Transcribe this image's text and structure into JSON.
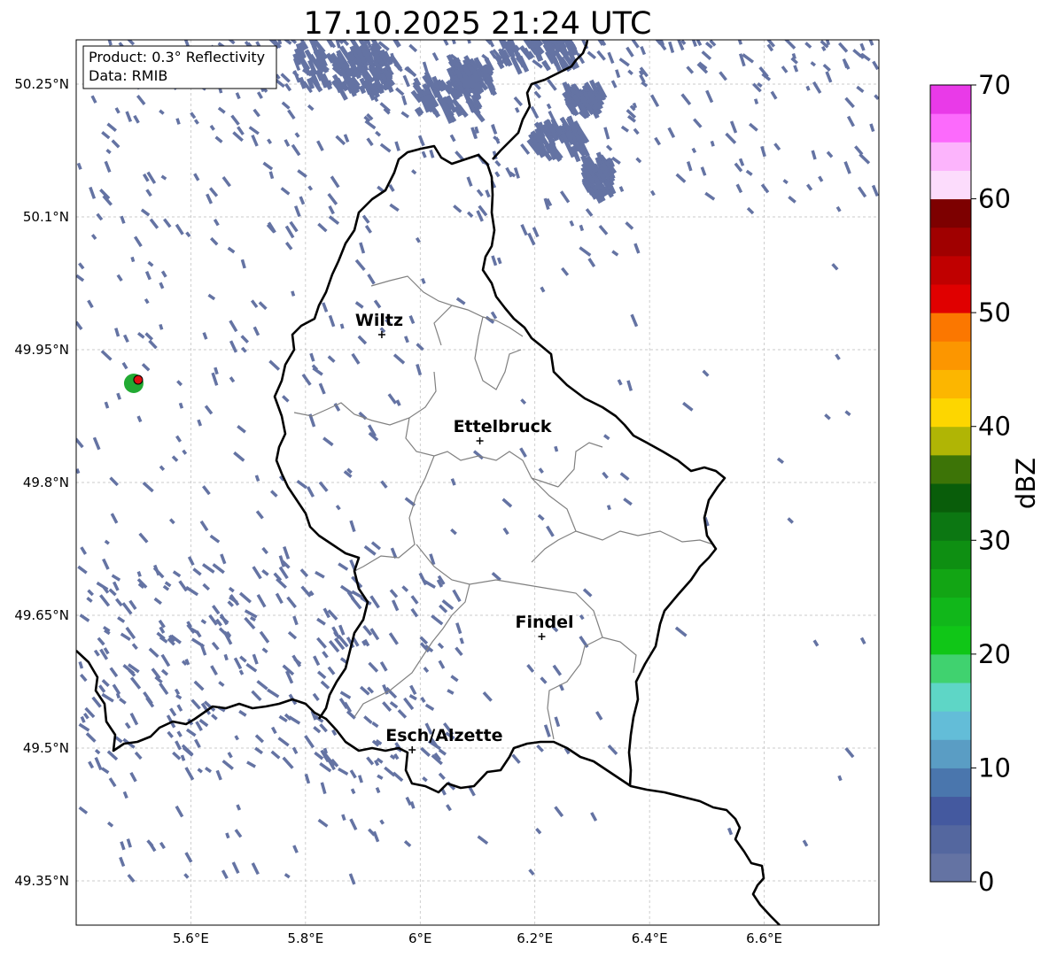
{
  "title": "17.10.2025 21:24 UTC",
  "info_box": {
    "line1": "Product: 0.3° Reflectivity",
    "line2": "Data: RMIB"
  },
  "map": {
    "lon_range": [
      5.4,
      6.8
    ],
    "lat_range": [
      49.3,
      50.3
    ],
    "lon_ticks": [
      5.6,
      5.8,
      6.0,
      6.2,
      6.4,
      6.6
    ],
    "lon_tick_labels": [
      "5.6°E",
      "5.8°E",
      "6°E",
      "6.2°E",
      "6.4°E",
      "6.6°E"
    ],
    "lat_ticks": [
      50.25,
      50.1,
      49.95,
      49.8,
      49.65,
      49.5,
      49.35
    ],
    "lat_tick_labels": [
      "50.25°N",
      "50.1°N",
      "49.95°N",
      "49.8°N",
      "49.65°N",
      "49.5°N",
      "49.35°N"
    ],
    "grid": true,
    "echo_color": "#6473a3",
    "radar_site": {
      "lon": 5.505,
      "lat": 49.914,
      "fill": "#dd1111",
      "ring": "#22aa33"
    },
    "cities": [
      {
        "name": "Wiltz",
        "lon": 5.933,
        "lat": 49.967
      },
      {
        "name": "Ettelbruck",
        "lon": 6.104,
        "lat": 49.847
      },
      {
        "name": "Findel",
        "lon": 6.212,
        "lat": 49.626
      },
      {
        "name": "Esch/Alzette",
        "lon": 5.986,
        "lat": 49.498
      }
    ]
  },
  "colorbar": {
    "label": "dBZ",
    "min": 0,
    "max": 70,
    "step": 2.5,
    "ticks": [
      0,
      10,
      20,
      30,
      40,
      50,
      60,
      70
    ],
    "tick_labels": [
      "0",
      "10",
      "20",
      "30",
      "40",
      "50",
      "60",
      "70"
    ],
    "colors": [
      "#6473a3",
      "#54679f",
      "#44599f",
      "#4a76ad",
      "#5a9dc4",
      "#63bdd8",
      "#5ed6c6",
      "#40d26f",
      "#10c617",
      "#11b71a",
      "#12a514",
      "#0e8f12",
      "#0c7712",
      "#095d0a",
      "#3d7407",
      "#b0b505",
      "#fdd600",
      "#fcb600",
      "#fc9600",
      "#fb7700",
      "#e00000",
      "#c00000",
      "#a00000",
      "#7d0000",
      "#fcdcfc",
      "#fcb4fc",
      "#fc6afc",
      "#e93ae8"
    ]
  }
}
